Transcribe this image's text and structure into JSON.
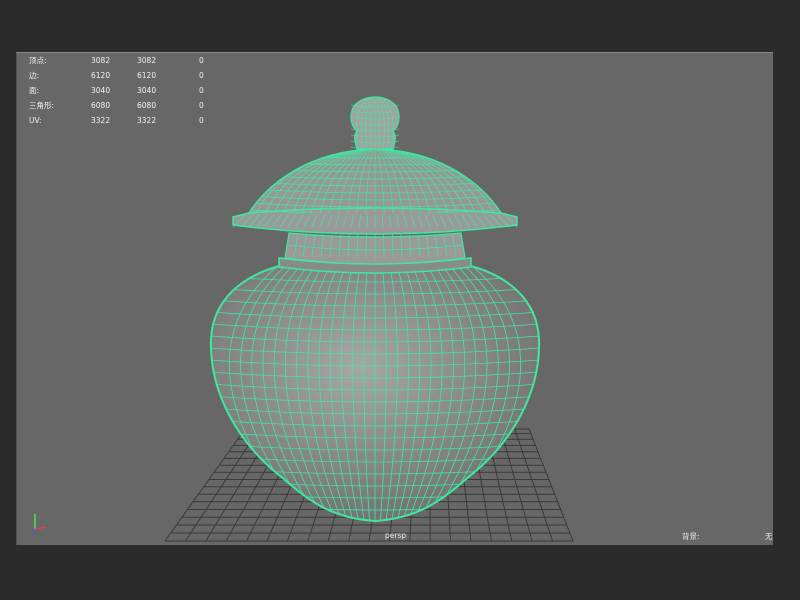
{
  "hud": {
    "rows": [
      {
        "label": "顶点:",
        "v1": "3082",
        "v2": "3082",
        "v3": "0"
      },
      {
        "label": "边:",
        "v1": "6120",
        "v2": "6120",
        "v3": "0"
      },
      {
        "label": "面:",
        "v1": "3040",
        "v2": "3040",
        "v3": "0"
      },
      {
        "label": "三角形:",
        "v1": "6080",
        "v2": "6080",
        "v3": "0"
      },
      {
        "label": "UV:",
        "v1": "3322",
        "v2": "3322",
        "v3": "0"
      }
    ]
  },
  "camera": "persp",
  "backface": {
    "label": "背景:",
    "value": "无"
  },
  "colors": {
    "wire": "#3fe8a0",
    "viewport_bg": "#676767",
    "grid": "#3a3a3a"
  },
  "axis": {
    "x": "x",
    "y": "y",
    "z": "z"
  }
}
